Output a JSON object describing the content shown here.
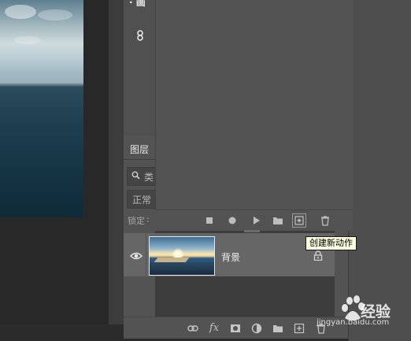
{
  "side_panel": {
    "top_item": "· 画"
  },
  "layers": {
    "tab_label": "图层",
    "filter_label": "类",
    "blend_mode": "正常",
    "lock_label": "锁定",
    "lock_colon": ":",
    "layer_name": "背景"
  },
  "tooltip": {
    "text": "创建新动作"
  },
  "watermark": {
    "logo_text": "经验",
    "url": "jingyan.baidu.com"
  },
  "icons": {
    "actions_toolbar": [
      "stop-icon",
      "record-icon",
      "play-icon",
      "folder-icon",
      "new-action-icon",
      "trash-icon"
    ],
    "layers_toolbar": [
      "link-icon",
      "fx-icon",
      "mask-icon",
      "adjustment-icon",
      "folder-icon",
      "new-layer-icon",
      "trash-icon"
    ]
  },
  "layers_toolbar_labels": {
    "fx": "fx"
  }
}
